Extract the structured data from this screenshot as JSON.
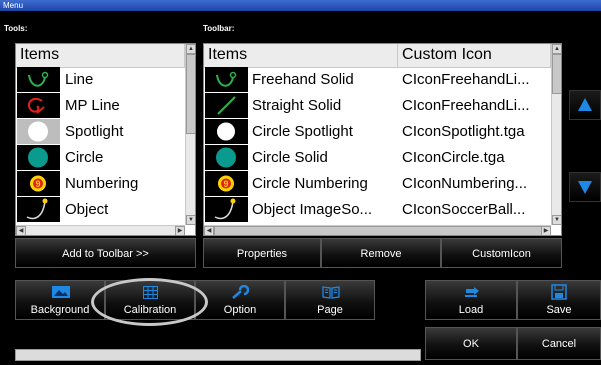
{
  "window": {
    "title": "Menu"
  },
  "tools": {
    "label": "Tools:",
    "header": "Items",
    "items": [
      {
        "label": "Line",
        "icon": "curved-line-icon"
      },
      {
        "label": "MP Line",
        "icon": "mp-line-icon"
      },
      {
        "label": "Spotlight",
        "icon": "spotlight-icon"
      },
      {
        "label": "Circle",
        "icon": "circle-icon"
      },
      {
        "label": "Numbering",
        "icon": "numbering-icon"
      },
      {
        "label": "Object",
        "icon": "object-icon"
      }
    ],
    "add_button": "Add to Toolbar >>"
  },
  "toolbar": {
    "label": "Toolbar:",
    "headers": [
      "Items",
      "Custom Icon"
    ],
    "rows": [
      {
        "item": "Freehand Solid",
        "icon_file": "CIconFreehandLi...",
        "icon": "curved-line-icon"
      },
      {
        "item": "Straight Solid",
        "icon_file": "CIconFreehandLi...",
        "icon": "straight-line-icon"
      },
      {
        "item": "Circle Spotlight",
        "icon_file": "CIconSpotlight.tga",
        "icon": "spotlight-icon"
      },
      {
        "item": "Circle Solid",
        "icon_file": "CIconCircle.tga",
        "icon": "circle-icon"
      },
      {
        "item": "Circle Numbering",
        "icon_file": "CIconNumbering...",
        "icon": "numbering-icon"
      },
      {
        "item": "Object ImageSo...",
        "icon_file": "CIconSoccerBall...",
        "icon": "object-icon"
      }
    ],
    "buttons": {
      "properties": "Properties",
      "remove": "Remove",
      "custom_icon": "CustomIcon"
    }
  },
  "number_glyph": "9",
  "bottom": {
    "tabs": [
      {
        "label": "Background",
        "icon": "image-icon"
      },
      {
        "label": "Calibration",
        "icon": "grid-icon"
      },
      {
        "label": "Option",
        "icon": "wrench-icon"
      },
      {
        "label": "Page",
        "icon": "book-icon"
      }
    ],
    "load": "Load",
    "save": "Save",
    "ok": "OK",
    "cancel": "Cancel"
  },
  "colors": {
    "accent": "#1e88e5",
    "icon_green": "#0a9a8e",
    "icon_red": "#e0201c",
    "number_yellow": "#ffd200",
    "highlight": "#c8c8c8"
  }
}
